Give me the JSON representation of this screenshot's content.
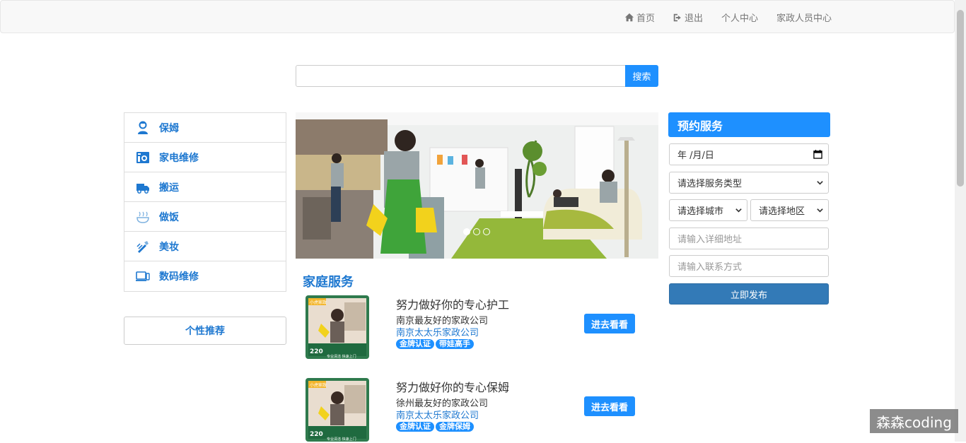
{
  "nav": {
    "home": "首页",
    "logout": "退出",
    "profile": "个人中心",
    "staff": "家政人员中心"
  },
  "search": {
    "placeholder": "",
    "button": "搜索"
  },
  "categories": [
    {
      "label": "保姆",
      "icon": "nanny-icon"
    },
    {
      "label": "家电维修",
      "icon": "appliance-icon"
    },
    {
      "label": "搬运",
      "icon": "truck-icon"
    },
    {
      "label": "做饭",
      "icon": "cooking-icon"
    },
    {
      "label": "美妆",
      "icon": "makeup-icon"
    },
    {
      "label": "数码维修",
      "icon": "laptop-icon"
    }
  ],
  "recommend": "个性推荐",
  "banner": {
    "slides": 3,
    "active_slide": 1
  },
  "section_title": "家庭服务",
  "services": [
    {
      "title": "努力做好你的专心护工",
      "subtitle": "南京最友好的家政公司",
      "company": "南京太太乐家政公司",
      "tags": [
        "金牌认证",
        "带娃高手"
      ],
      "button": "进去看看",
      "thumb": {
        "badge": "小虎家政",
        "price": "220",
        "caption": "专业清洁  快速上门"
      }
    },
    {
      "title": "努力做好你的专心保姆",
      "subtitle": "徐州最友好的家政公司",
      "company": "南京太太乐家政公司",
      "tags": [
        "金牌认证",
        "金牌保姆"
      ],
      "button": "进去看看",
      "thumb": {
        "badge": "小虎家政",
        "price": "220",
        "caption": "专业清洁  快速上门"
      }
    }
  ],
  "booking": {
    "title": "预约服务",
    "date": "年 /月/日",
    "service_type": "请选择服务类型",
    "city": "请选择城市",
    "district": "请选择地区",
    "address_placeholder": "请输入详细地址",
    "contact_placeholder": "请输入联系方式",
    "submit": "立即发布"
  },
  "watermark": "森森coding",
  "colors": {
    "accent": "#1e90ff",
    "primary_button": "#337ab7",
    "link": "#1e78d0"
  }
}
